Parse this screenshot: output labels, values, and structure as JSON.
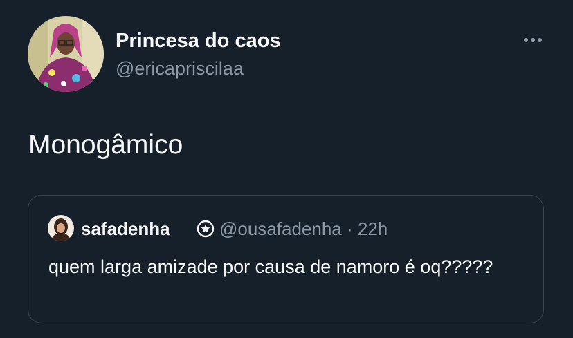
{
  "tweet": {
    "author": {
      "display_name": "Princesa do caos",
      "handle": "@ericapriscilaa"
    },
    "more_icon": "more-horizontal-icon",
    "text": "Monogâmico",
    "quoted": {
      "author": {
        "display_name": "safadenha",
        "badge_icon": "star-badge-icon",
        "handle_and_time": "@ousafadenha · 22h"
      },
      "text": "quem larga amizade por causa de namoro é oq?????"
    }
  },
  "colors": {
    "background": "#15202b",
    "primary_text": "#f7f9f9",
    "secondary_text": "#8b98a5",
    "border": "#38444d"
  }
}
